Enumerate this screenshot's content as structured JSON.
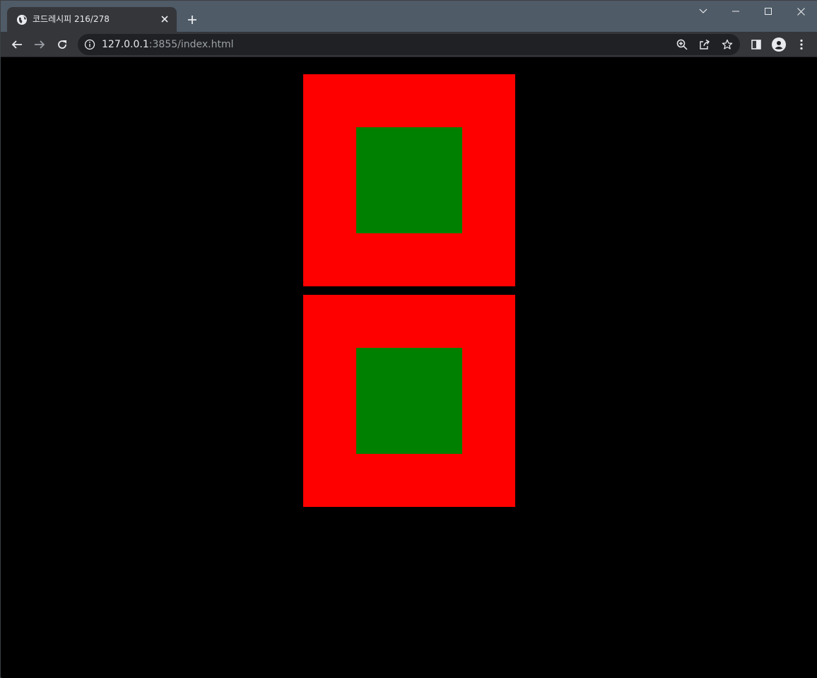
{
  "browser": {
    "tab": {
      "title": "코드레시피 216/278",
      "favicon": "globe-icon",
      "close_icon": "close-icon"
    },
    "new_tab_icon": "plus-icon",
    "window_controls": [
      "chevron-down-icon",
      "minimize-icon",
      "maximize-icon",
      "close-icon"
    ],
    "toolbar": {
      "back_icon": "arrow-left-icon",
      "forward_icon": "arrow-right-icon",
      "reload_icon": "reload-icon",
      "url_host": "127.0.0.1",
      "url_rest": ":3855/index.html",
      "omnibox_icons": [
        "zoom-icon",
        "share-icon",
        "star-icon"
      ],
      "right_icons": [
        "side-panel-icon",
        "profile-icon",
        "menu-icon"
      ]
    },
    "colors": {
      "tabstrip": "#4f5b67",
      "toolbar": "#35363a",
      "omnibox": "#202124"
    }
  },
  "page": {
    "background": "#000000",
    "boxes": [
      {
        "outer_color": "#ff0000",
        "inner_color": "#008000"
      },
      {
        "outer_color": "#ff0000",
        "inner_color": "#008000"
      }
    ]
  }
}
